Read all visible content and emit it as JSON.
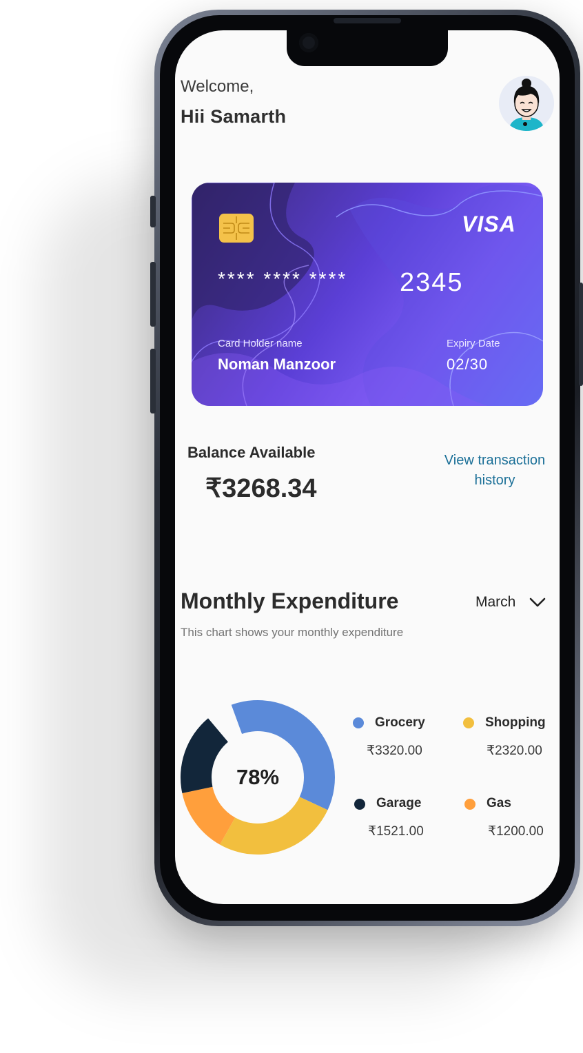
{
  "greeting": {
    "welcome": "Welcome,",
    "name": "Hii  Samarth"
  },
  "card": {
    "network": "VISA",
    "masked": "**** **** ****",
    "last4": "2345",
    "holder_label": "Card Holder name",
    "holder_name": "Noman Manzoor",
    "expiry_label": "Expiry Date",
    "expiry": "02/30"
  },
  "balance": {
    "label": "Balance Available",
    "amount": "₹3268.34",
    "link": "View transaction history"
  },
  "expenditure": {
    "title": "Monthly Expenditure",
    "subtitle": "This chart shows your monthly expenditure",
    "month": "March",
    "center_label": "78%"
  },
  "chart_data": {
    "type": "pie",
    "categories": [
      "Grocery",
      "Shopping",
      "Garage",
      "Gas"
    ],
    "values": [
      3320.0,
      2320.0,
      1521.0,
      1200.0
    ],
    "value_labels": [
      "₹3320.00",
      "₹2320.00",
      "₹1521.00",
      "₹1200.00"
    ],
    "colors": [
      "#5b8ad9",
      "#f2bf3e",
      "#12263a",
      "#ff9f3c"
    ],
    "center_label": "78%",
    "legend_position": "right"
  },
  "icons": {
    "chevron": "chevron-down-icon",
    "avatar": "avatar",
    "chip": "card-chip-icon"
  }
}
